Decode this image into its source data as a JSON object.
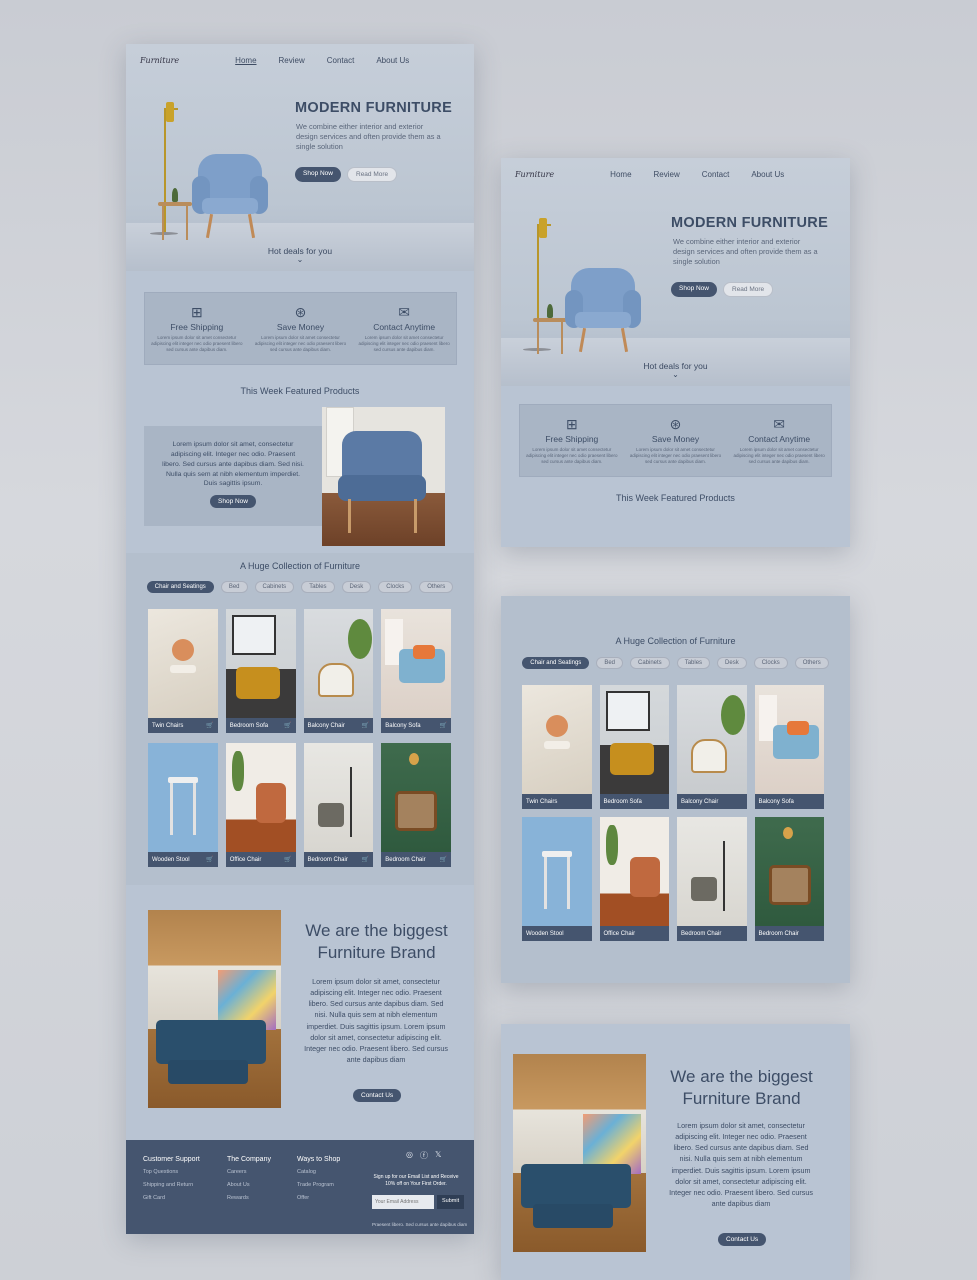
{
  "nav": {
    "logo": "Furniture",
    "links": [
      "Home",
      "Review",
      "Contact",
      "About Us"
    ]
  },
  "hero": {
    "title": "MODERN FURNITURE",
    "text": "We combine either interior and exterior design services and often provide them as a single solution",
    "shop_now": "Shop Now",
    "read_more": "Read More",
    "hot_deals": "Hot deals for you",
    "chevron": "chevron-down-icon"
  },
  "features": [
    {
      "icon": "cart-box-icon",
      "title": "Free Shipping",
      "text": "Lorem ipsum dolor sit amet consectetur adipiscing elit integer nec odio praesent libero sed cursus ante dapibus diam."
    },
    {
      "icon": "dollar-icon",
      "title": "Save Money",
      "text": "Lorem ipsum dolor sit amet consectetur adipiscing elit integer nec odio praesent libero sed cursus ante dapibus diam."
    },
    {
      "icon": "envelope-icon",
      "title": "Contact Anytime",
      "text": "Lorem ipsum dolor sit amet consectetur adipiscing elit integer nec odio praesent libero sed cursus ante dapibus diam."
    }
  ],
  "featured": {
    "title": "This Week Featured Products",
    "text": "Lorem ipsum dolor sit amet, consectetur adipiscing elit. Integer nec odio. Praesent libero. Sed cursus ante dapibus diam. Sed nisi. Nulla quis sem at nibh elementum imperdiet. Duis sagittis ipsum.",
    "button": "Shop Now"
  },
  "collection": {
    "title": "A Huge Collection of Furniture",
    "tabs": [
      "Chair and Seatings",
      "Bed",
      "Cabinets",
      "Tables",
      "Desk",
      "Clocks",
      "Others"
    ],
    "items": [
      "Twin Chairs",
      "Bedroom Sofa",
      "Balcony Chair",
      "Balcony Sofa",
      "Wooden Stool",
      "Office Chair",
      "Bedroom Chair",
      "Bedroom Chair"
    ]
  },
  "brand": {
    "title1": "We are the biggest",
    "title2": "Furniture Brand",
    "text": "Lorem ipsum dolor sit amet, consectetur adipiscing elit. Integer nec odio. Praesent libero. Sed cursus ante dapibus diam. Sed nisi. Nulla quis sem at nibh elementum imperdiet. Duis sagittis ipsum. Lorem ipsum dolor sit amet, consectetur adipiscing elit. Integer nec odio. Praesent libero. Sed cursus ante dapibus diam",
    "button": "Contact Us"
  },
  "footer": {
    "cols": [
      {
        "title": "Customer Support",
        "links": [
          "Top Questions",
          "Shipping and Return",
          "Gift Card"
        ]
      },
      {
        "title": "The Company",
        "links": [
          "Careers",
          "About Us",
          "Rewards"
        ]
      },
      {
        "title": "Ways to Shop",
        "links": [
          "Catalog",
          "Trade Program",
          "Offer"
        ]
      }
    ],
    "social": [
      "instagram-icon",
      "facebook-icon",
      "x-icon"
    ],
    "signup": "Sign up for our Email List and Receive 10% off on Your First Order.",
    "placeholder": "Your Email Address",
    "submit": "Submit",
    "copyright": "Praesent libero. Sed cursus ante dapibus diam"
  },
  "colors": {
    "accent": "#45556f",
    "bg": "#b9c4d3",
    "chair": "#7d9cc4",
    "lamp": "#c9a22a"
  }
}
